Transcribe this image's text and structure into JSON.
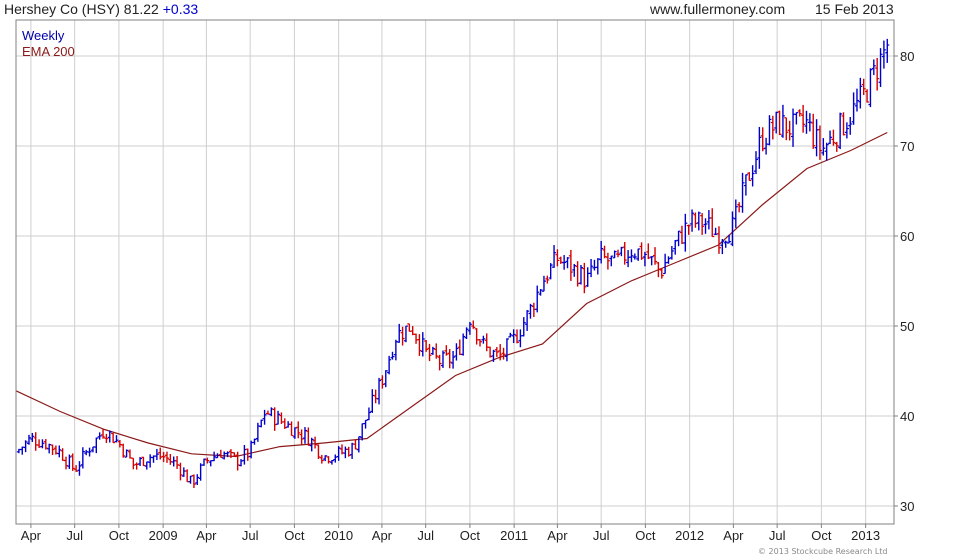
{
  "header": {
    "ticker_text": "Hershey Co (HSY) 81.22",
    "change_text": "+0.33",
    "site": "www.fullermoney.com",
    "date": "15 Feb 2013"
  },
  "legend": {
    "weekly_label": "Weekly",
    "ema_label": "EMA 200"
  },
  "copyright": "© 2013 Stockcube Research Ltd",
  "colors": {
    "up": "#0000cc",
    "down": "#d40000",
    "ema": "#8b1a1a",
    "grid": "#cfcfcf",
    "frame": "#808080",
    "change": "#0000cc"
  },
  "chart_data": {
    "type": "line",
    "subtype": "weekly price bars (up weeks blue, down weeks red)",
    "x_type": "date",
    "xlim": [
      "2008-03-01",
      "2013-03-01"
    ],
    "ylim": [
      28,
      84
    ],
    "ytick_values": [
      30,
      40,
      50,
      60,
      70,
      80
    ],
    "x_tick_labels": [
      {
        "label": "Apr",
        "date": "2008-04-01"
      },
      {
        "label": "Jul",
        "date": "2008-07-01"
      },
      {
        "label": "Oct",
        "date": "2008-10-01"
      },
      {
        "label": "2009",
        "date": "2009-01-01"
      },
      {
        "label": "Apr",
        "date": "2009-04-01"
      },
      {
        "label": "Jul",
        "date": "2009-07-01"
      },
      {
        "label": "Oct",
        "date": "2009-10-01"
      },
      {
        "label": "2010",
        "date": "2010-01-01"
      },
      {
        "label": "Apr",
        "date": "2010-04-01"
      },
      {
        "label": "Jul",
        "date": "2010-07-01"
      },
      {
        "label": "Oct",
        "date": "2010-10-01"
      },
      {
        "label": "2011",
        "date": "2011-01-01"
      },
      {
        "label": "Apr",
        "date": "2011-04-01"
      },
      {
        "label": "Jul",
        "date": "2011-07-01"
      },
      {
        "label": "Oct",
        "date": "2011-10-01"
      },
      {
        "label": "2012",
        "date": "2012-01-01"
      },
      {
        "label": "Apr",
        "date": "2012-04-01"
      },
      {
        "label": "Jul",
        "date": "2012-07-01"
      },
      {
        "label": "Oct",
        "date": "2012-10-01"
      },
      {
        "label": "2013",
        "date": "2013-01-01"
      }
    ],
    "grid": true,
    "legend_position": "top-left",
    "series": [
      {
        "name": "Weekly",
        "x": [
          "2008-03-01",
          "2008-04-01",
          "2008-05-01",
          "2008-06-01",
          "2008-07-01",
          "2008-08-01",
          "2008-09-01",
          "2008-10-01",
          "2008-11-01",
          "2008-12-01",
          "2009-01-01",
          "2009-02-01",
          "2009-03-01",
          "2009-04-01",
          "2009-05-01",
          "2009-06-01",
          "2009-07-01",
          "2009-08-01",
          "2009-09-01",
          "2009-10-01",
          "2009-11-01",
          "2009-12-01",
          "2010-01-01",
          "2010-02-01",
          "2010-03-01",
          "2010-04-01",
          "2010-05-01",
          "2010-06-01",
          "2010-07-01",
          "2010-08-01",
          "2010-09-01",
          "2010-10-01",
          "2010-11-01",
          "2010-12-01",
          "2011-01-01",
          "2011-02-01",
          "2011-03-01",
          "2011-04-01",
          "2011-05-01",
          "2011-06-01",
          "2011-07-01",
          "2011-08-01",
          "2011-09-01",
          "2011-10-01",
          "2011-11-01",
          "2011-12-01",
          "2012-01-01",
          "2012-02-01",
          "2012-03-01",
          "2012-04-01",
          "2012-05-01",
          "2012-06-01",
          "2012-07-01",
          "2012-08-01",
          "2012-09-01",
          "2012-10-01",
          "2012-11-01",
          "2012-12-01",
          "2013-01-01",
          "2013-02-15"
        ],
        "y": [
          36.0,
          37.5,
          37.0,
          36.0,
          34.0,
          36.5,
          38.5,
          37.0,
          34.5,
          35.5,
          35.5,
          34.5,
          32.5,
          35.0,
          36.0,
          35.0,
          36.0,
          40.5,
          39.5,
          38.5,
          37.5,
          35.5,
          35.8,
          36.5,
          40.0,
          44.0,
          49.0,
          50.0,
          47.0,
          46.0,
          46.5,
          51.0,
          47.5,
          46.5,
          48.5,
          51.5,
          55.0,
          57.5,
          56.5,
          55.0,
          57.5,
          57.0,
          58.5,
          58.0,
          56.0,
          59.0,
          61.5,
          61.5,
          60.0,
          61.0,
          66.5,
          71.0,
          72.5,
          72.0,
          72.5,
          69.5,
          71.5,
          73.5,
          76.0,
          81.22
        ]
      },
      {
        "name": "EMA 200",
        "x": [
          "2008-03-01",
          "2008-06-01",
          "2008-09-01",
          "2008-12-01",
          "2009-03-01",
          "2009-06-01",
          "2009-09-01",
          "2009-12-01",
          "2010-03-01",
          "2010-06-01",
          "2010-09-01",
          "2010-12-01",
          "2011-03-01",
          "2011-06-01",
          "2011-09-01",
          "2011-12-01",
          "2012-03-01",
          "2012-06-01",
          "2012-09-01",
          "2012-12-01",
          "2013-02-15"
        ],
        "y": [
          42.8,
          40.5,
          38.5,
          37.0,
          35.8,
          35.5,
          36.6,
          37.0,
          37.5,
          41.0,
          44.5,
          46.5,
          48.0,
          52.5,
          55.0,
          57.0,
          59.0,
          63.5,
          67.5,
          69.5,
          71.5
        ]
      }
    ]
  }
}
